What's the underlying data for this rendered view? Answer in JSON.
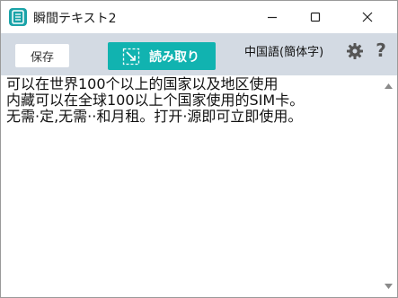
{
  "window": {
    "title": "瞬間テキスト2"
  },
  "titlebar": {
    "app_icon": "notepad-icon",
    "minimize_icon": "minimize-icon",
    "maximize_icon": "maximize-icon",
    "close_icon": "close-icon"
  },
  "toolbar": {
    "save_label": "保存",
    "read_label": "読み取り",
    "read_icon": "screen-capture-icon",
    "language": "中国語(簡体字)",
    "settings_icon": "gear-icon",
    "help_label": "?"
  },
  "content": {
    "lines": [
      "可以在世界100个以上的国家以及地区使用",
      "内藏可以在全球100以上个国家使用的SIM卡。",
      "无需·定,无需··和月租。打开·源即可立即使用。"
    ]
  },
  "colors": {
    "toolbar_bg": "#d3dae3",
    "accent": "#11b3b0",
    "app_icon": "#1aa3a8"
  }
}
